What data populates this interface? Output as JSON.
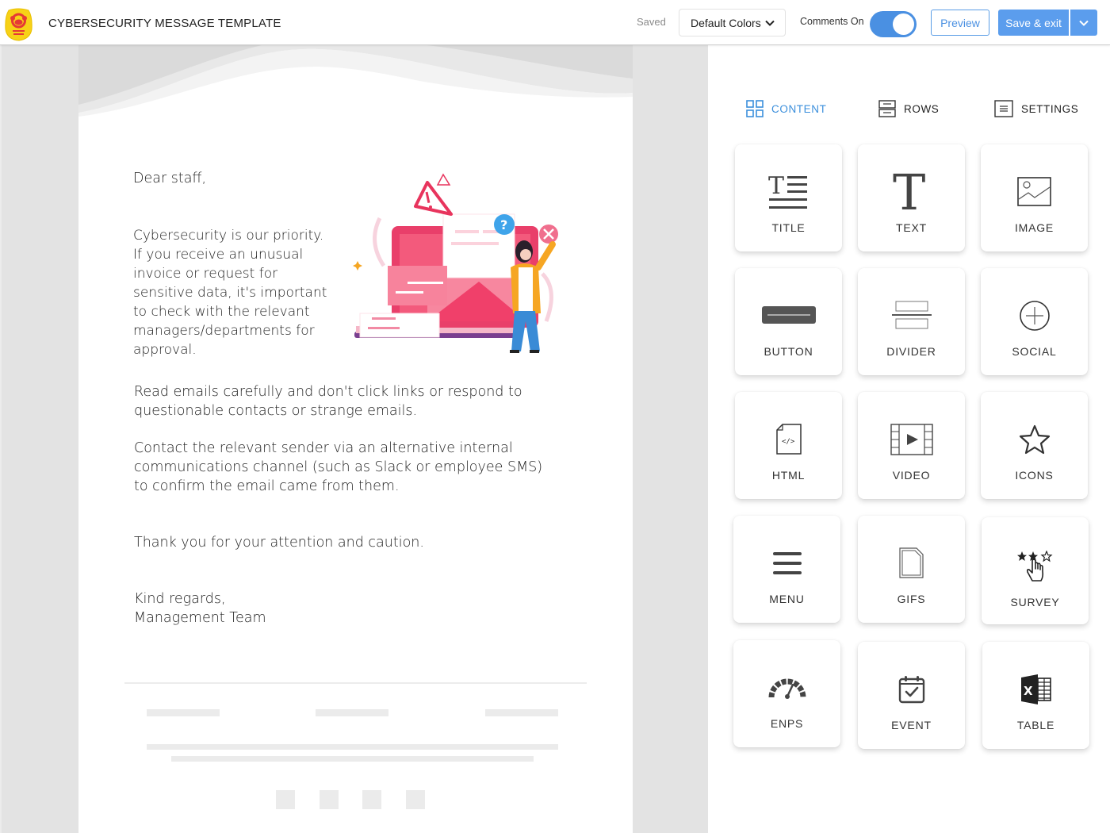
{
  "app": {
    "title": "CYBERSECURITY MESSAGE TEMPLATE",
    "logo_icon": "monkey-logo-icon"
  },
  "toolbar": {
    "status": "Saved",
    "color_scheme": {
      "selected": "Default Colors"
    },
    "comments_label": "Comments On",
    "comments_enabled": true,
    "preview_label": "Preview",
    "save_label": "Save & exit"
  },
  "email": {
    "greeting": "Dear staff,",
    "paragraphs": [
      "Cybersecurity is our priority.\nIf you receive an unusual\ninvoice or request for\nsensitive data, it's important\nto check with the relevant\nmanagers/departments for\napproval.",
      "Read emails carefully and don't click links or respond to\nquestionable contacts or strange emails.",
      "Contact the relevant sender via an alternative internal\ncommunications channel (such as Slack or employee SMS)\nto confirm the email came from them.",
      "Thank you for your attention and caution."
    ],
    "signoff": "Kind regards,\nManagement Team",
    "illustration_icon": "phishing-warning-illustration"
  },
  "panel": {
    "tabs": [
      {
        "label": "CONTENT",
        "icon": "grid-icon",
        "active": true
      },
      {
        "label": "ROWS",
        "icon": "rows-icon",
        "active": false
      },
      {
        "label": "SETTINGS",
        "icon": "settings-icon",
        "active": false
      }
    ],
    "blocks": [
      {
        "label": "TITLE",
        "icon": "title-icon"
      },
      {
        "label": "TEXT",
        "icon": "text-icon"
      },
      {
        "label": "IMAGE",
        "icon": "image-icon"
      },
      {
        "label": "BUTTON",
        "icon": "button-icon"
      },
      {
        "label": "DIVIDER",
        "icon": "divider-icon"
      },
      {
        "label": "SOCIAL",
        "icon": "social-icon"
      },
      {
        "label": "HTML",
        "icon": "html-icon"
      },
      {
        "label": "VIDEO",
        "icon": "video-icon"
      },
      {
        "label": "ICONS",
        "icon": "star-icon"
      },
      {
        "label": "MENU",
        "icon": "menu-icon"
      },
      {
        "label": "GIFS",
        "icon": "gif-icon"
      },
      {
        "label": "SURVEY",
        "icon": "survey-icon"
      },
      {
        "label": "ENPS",
        "icon": "gauge-icon"
      },
      {
        "label": "EVENT",
        "icon": "calendar-check-icon"
      },
      {
        "label": "TABLE",
        "icon": "spreadsheet-icon"
      }
    ]
  },
  "colors": {
    "accent": "#4a90e2",
    "primary_button": "#5b9ded",
    "active_tab": "#3b8fdc",
    "canvas_bg": "#e3e3e3",
    "logo_yellow": "#f7d117",
    "logo_red": "#e53935"
  }
}
